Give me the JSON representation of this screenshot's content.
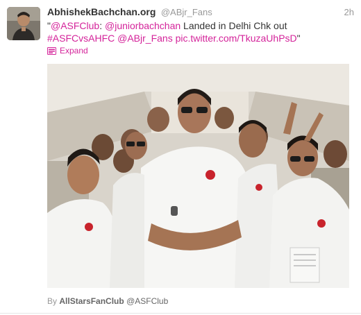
{
  "tweet": {
    "display_name": "AbhishekBachchan.org",
    "screen_name": "@ABjr_Fans",
    "timestamp": "2h",
    "text": {
      "open_quote": "\"",
      "mention_1": "@ASFClub",
      "colon": ": ",
      "mention_2": "@juniorbachchan",
      "body": "  Landed in Delhi Chk out",
      "hashtag": "#ASFCvsAHFC",
      "mention_3": "@ABjr_Fans",
      "link": "pic.twitter.com/TkuzaUhPsD",
      "close_quote": "\""
    },
    "expand_label": "Expand",
    "attribution": {
      "prefix": "By",
      "name": "AllStarsFanClub",
      "handle": "@ASFClub"
    }
  },
  "colors": {
    "link": "#d4239a",
    "name": "#333333",
    "muted": "#999999"
  },
  "icons": {
    "expand": "photo-card-icon"
  }
}
